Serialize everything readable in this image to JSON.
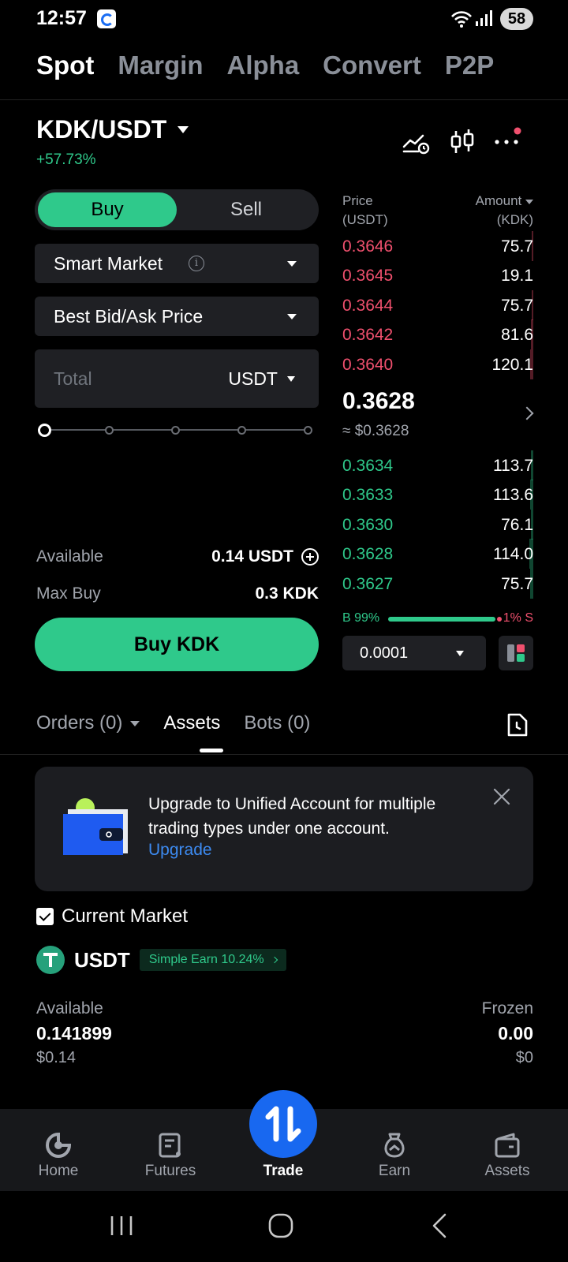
{
  "status_bar": {
    "time": "12:57",
    "battery": "58"
  },
  "top_tabs": [
    "Spot",
    "Margin",
    "Alpha",
    "Convert",
    "P2P"
  ],
  "pair": {
    "name": "KDK/USDT",
    "change": "+57.73%"
  },
  "order_form": {
    "buy_label": "Buy",
    "sell_label": "Sell",
    "order_type": "Smart Market",
    "price_mode": "Best Bid/Ask Price",
    "total_placeholder": "Total",
    "total_currency": "USDT",
    "available_label": "Available",
    "available_value": "0.14 USDT",
    "max_buy_label": "Max Buy",
    "max_buy_value": "0.3 KDK",
    "submit_label": "Buy KDK",
    "slider_percent": 0
  },
  "order_book": {
    "price_header": "Price",
    "price_unit": "(USDT)",
    "amount_header": "Amount",
    "amount_unit": "(KDK)",
    "asks": [
      {
        "price": "0.3646",
        "amount": "75.7"
      },
      {
        "price": "0.3645",
        "amount": "19.1"
      },
      {
        "price": "0.3644",
        "amount": "75.7"
      },
      {
        "price": "0.3642",
        "amount": "81.6"
      },
      {
        "price": "0.3640",
        "amount": "120.1"
      }
    ],
    "last_price": "0.3628",
    "last_price_usd": "≈ $0.3628",
    "bids": [
      {
        "price": "0.3634",
        "amount": "113.7"
      },
      {
        "price": "0.3633",
        "amount": "113.6"
      },
      {
        "price": "0.3630",
        "amount": "76.1"
      },
      {
        "price": "0.3628",
        "amount": "114.0"
      },
      {
        "price": "0.3627",
        "amount": "75.7"
      }
    ],
    "buy_ratio": "B 99%",
    "sell_ratio": "1% S",
    "precision": "0.0001"
  },
  "colors": {
    "buy": "#2fc98b",
    "sell": "#f0506e",
    "accent": "#1868f0",
    "link": "#3d8bf2"
  },
  "sub_tabs": {
    "orders": "Orders (0)",
    "assets": "Assets",
    "bots": "Bots (0)"
  },
  "banner": {
    "text": "Upgrade to Unified Account for multiple trading types under one account.",
    "link": "Upgrade"
  },
  "current_market_label": "Current Market",
  "asset": {
    "coin": "USDT",
    "earn_badge": "Simple Earn 10.24%",
    "available_label": "Available",
    "available_value": "0.141899",
    "available_usd": "$0.14",
    "frozen_label": "Frozen",
    "frozen_value": "0.00",
    "frozen_usd": "$0"
  },
  "bottom_nav": [
    "Home",
    "Futures",
    "Trade",
    "Earn",
    "Assets"
  ]
}
